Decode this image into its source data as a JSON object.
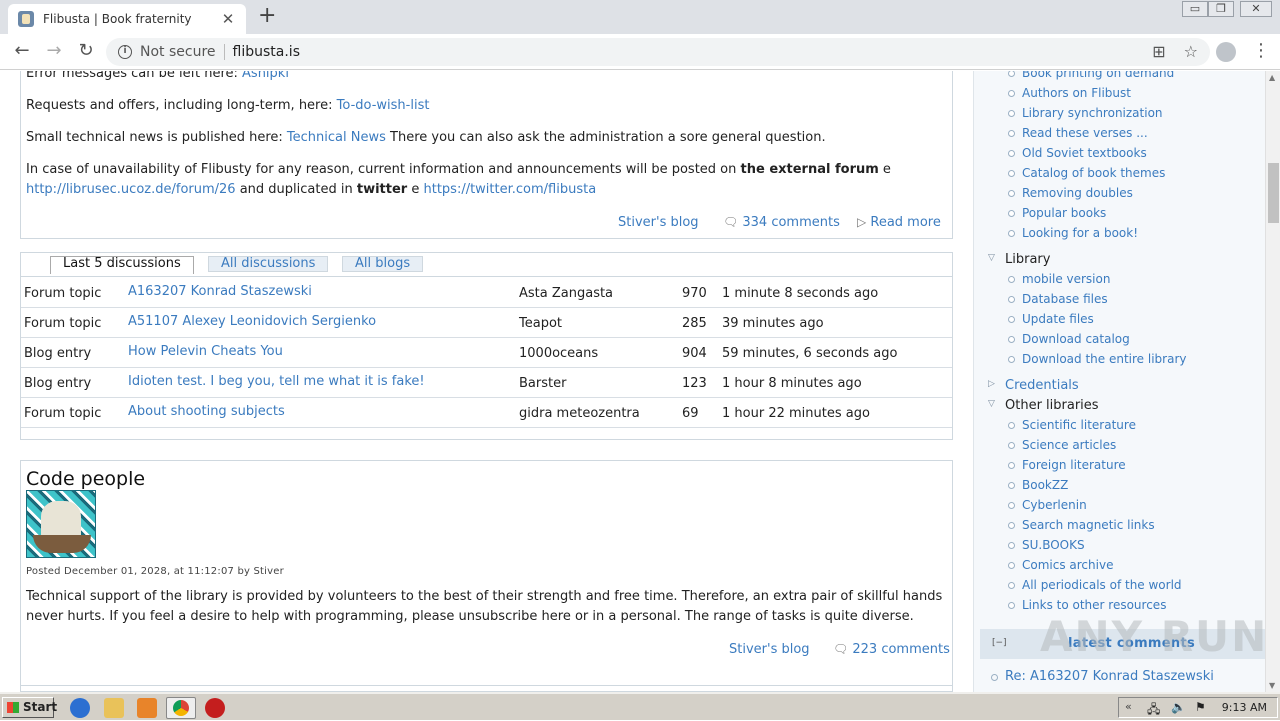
{
  "browser": {
    "tab_title": "Flibusta | Book fraternity",
    "tab_close": "✕",
    "new_tab": "+",
    "security_label": "Not secure",
    "url": "flibusta.is",
    "window_controls": [
      "▭",
      "❐",
      "✕"
    ]
  },
  "info_box": {
    "line_error": "Error messages can be left here:",
    "line_error_link": "Ashipki",
    "line_requests": "Requests and offers, including long-term, here:",
    "line_requests_link": "To-do-wish-list",
    "line_news": "Small technical news is published here:",
    "line_news_link": "Technical News",
    "line_news_tail": "There you can also ask the administration a sore general question.",
    "line_unavail_1": "In case of unavailability of Flibusty for any reason, current information and announcements will be posted on",
    "line_unavail_bold": "the external forum",
    "line_unavail_e": "e",
    "line_unavail_link": "http://librusec.ucoz.de/forum/26",
    "line_unavail_dup": "and duplicated in",
    "line_unavail_twitter": "twitter",
    "line_unavail_e2": "e",
    "line_unavail_twitter_link": "https://twitter.com/flibusta",
    "blog_link": "Stiver's blog",
    "comments": "334 comments",
    "read_more": "Read more"
  },
  "discussions": {
    "tab_active": "Last 5 discussions",
    "tab_all_discussions": "All discussions",
    "tab_all_blogs": "All blogs",
    "rows": [
      {
        "type": "Forum topic",
        "title": "A163207 Konrad Staszewski",
        "author": "Asta Zangasta",
        "count": "970",
        "time": "1 minute 8 seconds ago"
      },
      {
        "type": "Forum topic",
        "title": "A51107 Alexey Leonidovich Sergienko",
        "author": "Teapot",
        "count": "285",
        "time": "39 minutes ago"
      },
      {
        "type": "Blog entry",
        "title": "How Pelevin Cheats You",
        "author": "1000oceans",
        "count": "904",
        "time": "59 minutes, 6 seconds ago"
      },
      {
        "type": "Blog entry",
        "title": "Idioten test. I beg you, tell me what it is fake!",
        "author": "Barster",
        "count": "123",
        "time": "1 hour 8 minutes ago"
      },
      {
        "type": "Forum topic",
        "title": "About shooting subjects",
        "author": "gidra meteozentra",
        "count": "69",
        "time": "1 hour 22 minutes ago"
      }
    ]
  },
  "code_people": {
    "title": "Code people",
    "meta": "Posted December 01, 2028, at 11:12:07 by Stiver",
    "body_1": "Technical support of the library is provided by volunteers to the best of their strength and free time. Therefore, an extra pair of skillful hands",
    "body_2": "never hurts. If you feel a desire to help with programming, please unsubscribe here or in a personal. The range of tasks is quite diverse.",
    "blog_link": "Stiver's blog",
    "comments": "223 comments"
  },
  "sidebar": {
    "top_items": [
      "Book printing on demand",
      "Authors on Flibust",
      "Library synchronization",
      "Read these verses ...",
      "Old Soviet textbooks",
      "Catalog of book themes",
      "Removing doubles",
      "Popular books",
      "Looking for a book!"
    ],
    "library_title": "Library",
    "library_items": [
      "mobile version",
      "Database files",
      "Update files",
      "Download catalog",
      "Download the entire library"
    ],
    "credentials": "Credentials",
    "other_title": "Other libraries",
    "other_items": [
      "Scientific literature",
      "Science articles",
      "Foreign literature",
      "BookZZ",
      "Cyberlenin",
      "Search magnetic links",
      "SU.BOOKS",
      "Comics archive",
      "All periodicals of the world",
      "Links to other resources"
    ],
    "latest_toggle": "[−]",
    "latest_title": "latest comments",
    "latest_first": "Re: A163207 Konrad Staszewski"
  },
  "watermark": "ANY RUN",
  "taskbar": {
    "start": "Start",
    "clock": "9:13 AM"
  }
}
